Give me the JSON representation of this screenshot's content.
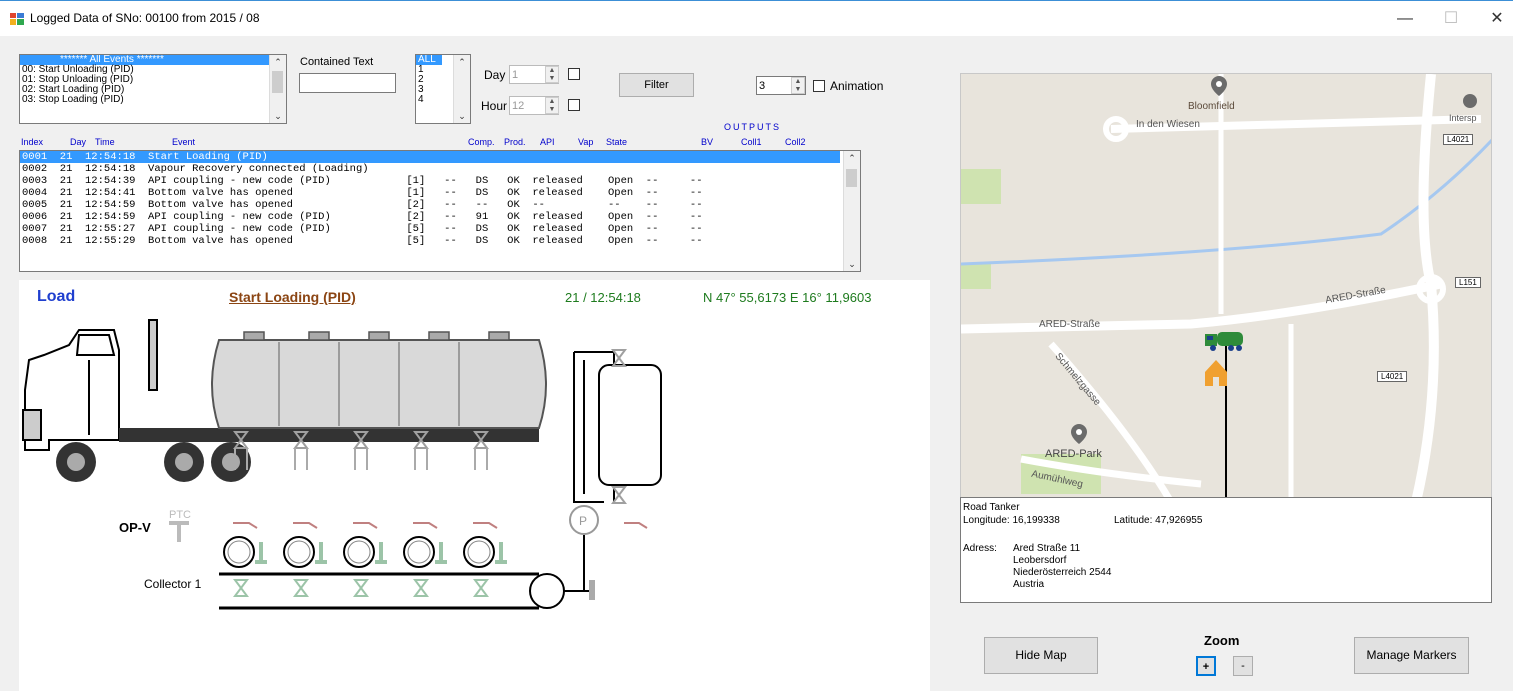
{
  "window": {
    "title": "Logged Data of SNo: 00100 from 2015 / 08",
    "minimize": "—",
    "maximize": "☐",
    "close": "✕"
  },
  "events_list": {
    "items": [
      "******* All Events *******",
      "00: Start Unloading (PID)",
      "01: Stop Unloading (PID)",
      "02: Start Loading (PID)",
      "03: Stop Loading (PID)"
    ]
  },
  "contained_text": {
    "label": "Contained Text",
    "value": ""
  },
  "comp_list": {
    "items": [
      "ALL",
      "1",
      "2",
      "3",
      "4"
    ]
  },
  "day": {
    "label": "Day",
    "value": "1"
  },
  "hour": {
    "label": "Hour",
    "value": "12"
  },
  "filter_label": "Filter",
  "animation": {
    "value": "3",
    "label": "Animation"
  },
  "grid": {
    "headers": {
      "index": "Index",
      "day": "Day",
      "time": "Time",
      "event": "Event",
      "comp": "Comp.",
      "prod": "Prod.",
      "api": "API",
      "vap": "Vap",
      "state": "State",
      "outputs": "OUTPUTS",
      "bv": "BV",
      "coll1": "Coll1",
      "coll2": "Coll2"
    },
    "rows": [
      "0001  21  12:54:18  Start Loading (PID)",
      "0002  21  12:54:18  Vapour Recovery connected (Loading)",
      "0003  21  12:54:39  API coupling - new code (PID)            [1]   --   DS   OK  released    Open  --     --",
      "0004  21  12:54:41  Bottom valve has opened                  [1]   --   DS   OK  released    Open  --     --",
      "0005  21  12:54:59  Bottom valve has opened                  [2]   --   --   OK  --          --    --     --",
      "0006  21  12:54:59  API coupling - new code (PID)            [2]   --   91   OK  released    Open  --     --",
      "0007  21  12:55:27  API coupling - new code (PID)            [5]   --   DS   OK  released    Open  --     --",
      "0008  21  12:55:29  Bottom valve has opened                  [5]   --   DS   OK  released    Open  --     --"
    ]
  },
  "drawing": {
    "mode": "Load",
    "event": "Start Loading (PID)",
    "timestamp": "21 / 12:54:18",
    "coords": "N 47° 55,6173 E 16° 11,9603",
    "opv_label": "OP-V",
    "ptc_label": "PTC",
    "collector_label": "Collector 1",
    "pump_label": "P"
  },
  "map": {
    "labels": {
      "bloomfield": "Bloomfield",
      "inden": "In den Wiesen",
      "intersp": "Intersp",
      "l4021a": "L4021",
      "l151": "L151",
      "ared_strasse_left": "ARED-Straße",
      "ared_strasse_right": "ARED-Straße",
      "schmelz": "Schmelzgasse",
      "l4021b": "L4021",
      "ared_park": "ARED-Park",
      "aumuhl": "Aumühlweg"
    }
  },
  "info": {
    "title": "Road Tanker",
    "longitude": "Longitude: 16,199338",
    "latitude": "Latitude: 47,926955",
    "adress_label": "Adress:",
    "line1": "Ared Straße 11",
    "line2": "Leobersdorf",
    "line3": "Niederösterreich 2544",
    "line4": "Austria"
  },
  "buttons": {
    "hide_map": "Hide Map",
    "zoom": "Zoom",
    "zoom_in": "+",
    "zoom_out": "-",
    "manage_markers": "Manage Markers"
  },
  "colors": {
    "selection": "#3399ff",
    "mode_blue": "#1f3fcf",
    "event_brown": "#8b4513",
    "coord_green": "#1e7b1e",
    "valve_gray": "#a0a0a0",
    "valve_green": "#9cc4a8",
    "tanker_green": "#2e8b3a"
  }
}
